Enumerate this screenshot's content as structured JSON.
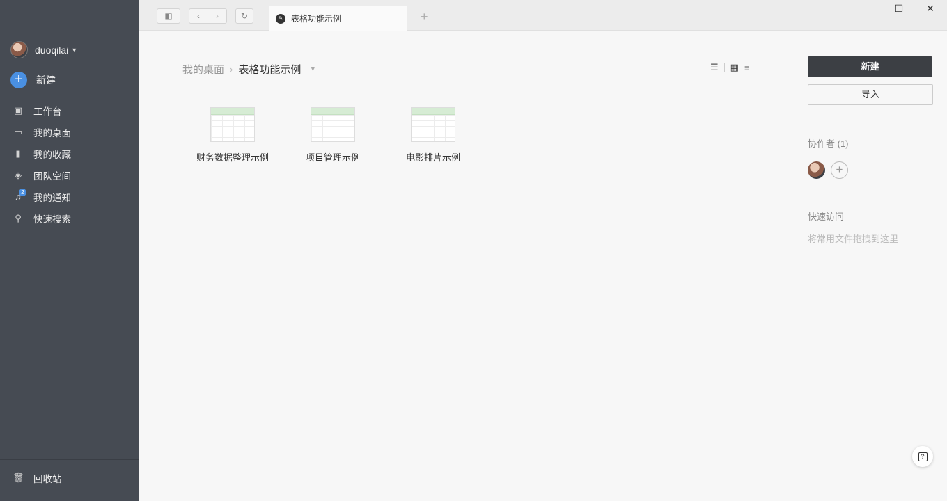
{
  "user": {
    "name": "duoqilai"
  },
  "sidebar": {
    "new_label": "新建",
    "items": [
      {
        "label": "工作台",
        "icon": "box-icon"
      },
      {
        "label": "我的桌面",
        "icon": "desktop-icon"
      },
      {
        "label": "我的收藏",
        "icon": "bookmark-icon"
      },
      {
        "label": "团队空间",
        "icon": "cube-icon"
      },
      {
        "label": "我的通知",
        "icon": "bell-icon",
        "badge": "2"
      },
      {
        "label": "快速搜索",
        "icon": "search-icon"
      }
    ],
    "trash_label": "回收站"
  },
  "tab": {
    "label": "表格功能示例"
  },
  "breadcrumb": {
    "root": "我的桌面",
    "current": "表格功能示例"
  },
  "files": [
    {
      "name": "财务数据整理示例"
    },
    {
      "name": "项目管理示例"
    },
    {
      "name": "电影排片示例"
    }
  ],
  "actions": {
    "new_label": "新建",
    "import_label": "导入"
  },
  "collaborators": {
    "title": "协作者 (1)"
  },
  "quick_access": {
    "title": "快速访问",
    "hint": "将常用文件拖拽到这里"
  },
  "colors": {
    "sidebar": "#464b53",
    "accent": "#4a90e2",
    "primary_button": "#3c3f44"
  }
}
